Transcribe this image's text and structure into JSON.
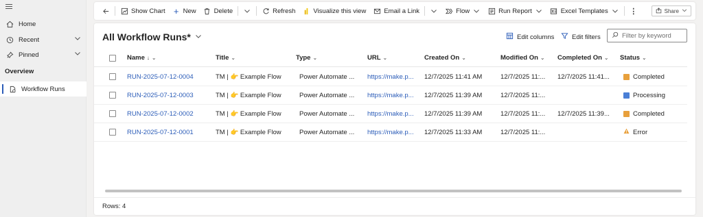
{
  "sidebar": {
    "items": [
      {
        "label": "Home",
        "icon": "home-icon"
      },
      {
        "label": "Recent",
        "icon": "clock-icon"
      },
      {
        "label": "Pinned",
        "icon": "pin-icon"
      }
    ],
    "section_label": "Overview",
    "active_item": {
      "label": "Workflow Runs",
      "icon": "document-icon"
    }
  },
  "toolbar": {
    "show_chart": "Show Chart",
    "new": "New",
    "delete": "Delete",
    "refresh": "Refresh",
    "visualize": "Visualize this view",
    "email_link": "Email a Link",
    "flow": "Flow",
    "run_report": "Run Report",
    "excel_templates": "Excel Templates",
    "share": "Share"
  },
  "view": {
    "title": "All Workflow Runs*",
    "edit_columns": "Edit columns",
    "edit_filters": "Edit filters",
    "filter_placeholder": "Filter by keyword"
  },
  "grid": {
    "columns": [
      "Name",
      "Title",
      "Type",
      "URL",
      "Created On",
      "Modified On",
      "Completed On",
      "Status"
    ],
    "name_sort_indicator": "↓",
    "rows": [
      {
        "name": "RUN-2025-07-12-0004",
        "title": "TM | 👉 Example Flow",
        "type": "Power Automate ...",
        "url": "https://make.p...",
        "created": "12/7/2025 11:41 AM",
        "modified": "12/7/2025 11:...",
        "completed": "12/7/2025 11:41...",
        "status": "Completed"
      },
      {
        "name": "RUN-2025-07-12-0003",
        "title": "TM | 👉 Example Flow",
        "type": "Power Automate ...",
        "url": "https://make.p...",
        "created": "12/7/2025 11:39 AM",
        "modified": "12/7/2025 11:...",
        "completed": "",
        "status": "Processing"
      },
      {
        "name": "RUN-2025-07-12-0002",
        "title": "TM | 👉 Example Flow",
        "type": "Power Automate ...",
        "url": "https://make.p...",
        "created": "12/7/2025 11:39 AM",
        "modified": "12/7/2025 11:...",
        "completed": "12/7/2025 11:39...",
        "status": "Completed"
      },
      {
        "name": "RUN-2025-07-12-0001",
        "title": "TM | 👉 Example Flow",
        "type": "Power Automate ...",
        "url": "https://make.p...",
        "created": "12/7/2025 11:33 AM",
        "modified": "12/7/2025 11:...",
        "completed": "",
        "status": "Error"
      }
    ],
    "status_colors": {
      "Completed": "#e8a03c",
      "Processing": "#4a7fd6",
      "Error": "#e8a03c"
    }
  },
  "footer": {
    "rows_count": "Rows: 4"
  },
  "colors": {
    "accent": "#2b5cb8",
    "link": "#2b5cb8"
  }
}
